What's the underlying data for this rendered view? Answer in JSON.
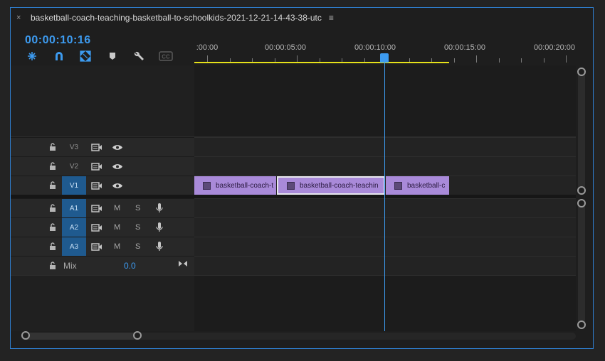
{
  "sequence": {
    "title": "basketball-coach-teaching-basketball-to-schoolkids-2021-12-21-14-43-38-utc",
    "close_glyph": "×",
    "menu_glyph": "≡",
    "timecode": "00:00:10:16"
  },
  "toolbar": {
    "items": [
      "nest-sequence-icon",
      "snap-magnet-icon",
      "linked-selection-icon",
      "add-marker-icon",
      "wrench-settings-icon",
      "captions-icon"
    ],
    "captions_label": "CC"
  },
  "ruler": {
    "labels": [
      ":00:00",
      "00:00:05:00",
      "00:00:10:00",
      "00:00:15:00",
      "00:00:20:00"
    ]
  },
  "tracks": {
    "video": [
      {
        "name": "V3",
        "active": false
      },
      {
        "name": "V2",
        "active": false
      },
      {
        "name": "V1",
        "active": true
      }
    ],
    "audio": [
      {
        "name": "A1",
        "mute": "M",
        "solo": "S"
      },
      {
        "name": "A2",
        "mute": "M",
        "solo": "S"
      },
      {
        "name": "A3",
        "mute": "M",
        "solo": "S"
      }
    ],
    "mix": {
      "label": "Mix",
      "value": "0.0"
    }
  },
  "clips": [
    {
      "label": "basketball-coach-t",
      "selected": false
    },
    {
      "label": "basketball-coach-teachin",
      "selected": true
    },
    {
      "label": "basketball-c",
      "selected": false
    }
  ],
  "colors": {
    "accent": "#3d9bf0",
    "clip": "#a98ad9",
    "work_area": "#e6e21a",
    "border": "#2f7fd0"
  }
}
